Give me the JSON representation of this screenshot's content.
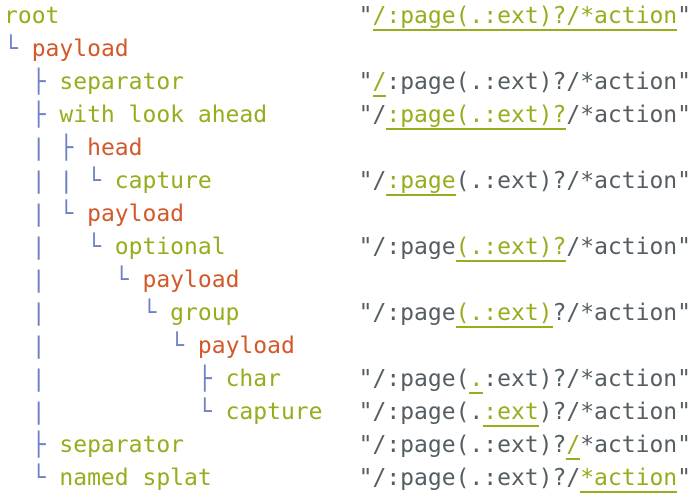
{
  "rows": [
    {
      "prefix": "",
      "label": "root",
      "payload": false,
      "pattern": [
        "\"",
        "/:page(.:ext)?/*action",
        "\""
      ],
      "hl": 1
    },
    {
      "prefix": "└ ",
      "label": "payload",
      "payload": true,
      "pattern": null
    },
    {
      "prefix": "  ├ ",
      "label": "separator",
      "payload": false,
      "pattern": [
        "\"",
        "/",
        ":page(.:ext)?/*action\""
      ],
      "hl": 1
    },
    {
      "prefix": "  ├ ",
      "label": "with look ahead",
      "payload": false,
      "pattern": [
        "\"/",
        ":page(.:ext)?",
        "/*action\""
      ],
      "hl": 1
    },
    {
      "prefix": "  | ├ ",
      "label": "head",
      "payload": true,
      "pattern": null
    },
    {
      "prefix": "  | | └ ",
      "label": "capture",
      "payload": false,
      "pattern": [
        "\"/",
        ":page",
        "(.:ext)?/*action\""
      ],
      "hl": 1
    },
    {
      "prefix": "  | └ ",
      "label": "payload",
      "payload": true,
      "pattern": null
    },
    {
      "prefix": "  |   └ ",
      "label": "optional",
      "payload": false,
      "pattern": [
        "\"/:page",
        "(.:ext)?",
        "/*action\""
      ],
      "hl": 1
    },
    {
      "prefix": "  |     └ ",
      "label": "payload",
      "payload": true,
      "pattern": null
    },
    {
      "prefix": "  |       └ ",
      "label": "group",
      "payload": false,
      "pattern": [
        "\"/:page",
        "(.:ext)",
        "?/*action\""
      ],
      "hl": 1
    },
    {
      "prefix": "  |         └ ",
      "label": "payload",
      "payload": true,
      "pattern": null
    },
    {
      "prefix": "  |           ├ ",
      "label": "char",
      "payload": false,
      "pattern": [
        "\"/:page(",
        ".",
        ":ext)?/*action\""
      ],
      "hl": 1
    },
    {
      "prefix": "  |           └ ",
      "label": "capture",
      "payload": false,
      "pattern": [
        "\"/:page(.",
        ":ext",
        ")?/*action\""
      ],
      "hl": 1
    },
    {
      "prefix": "  ├ ",
      "label": "separator",
      "payload": false,
      "pattern": [
        "\"/:page(.:ext)?",
        "/",
        "*action\""
      ],
      "hl": 1
    },
    {
      "prefix": "  └ ",
      "label": "named splat",
      "payload": false,
      "pattern": [
        "\"/:page(.:ext)?/",
        "*action",
        "\""
      ],
      "hl": 1
    }
  ]
}
